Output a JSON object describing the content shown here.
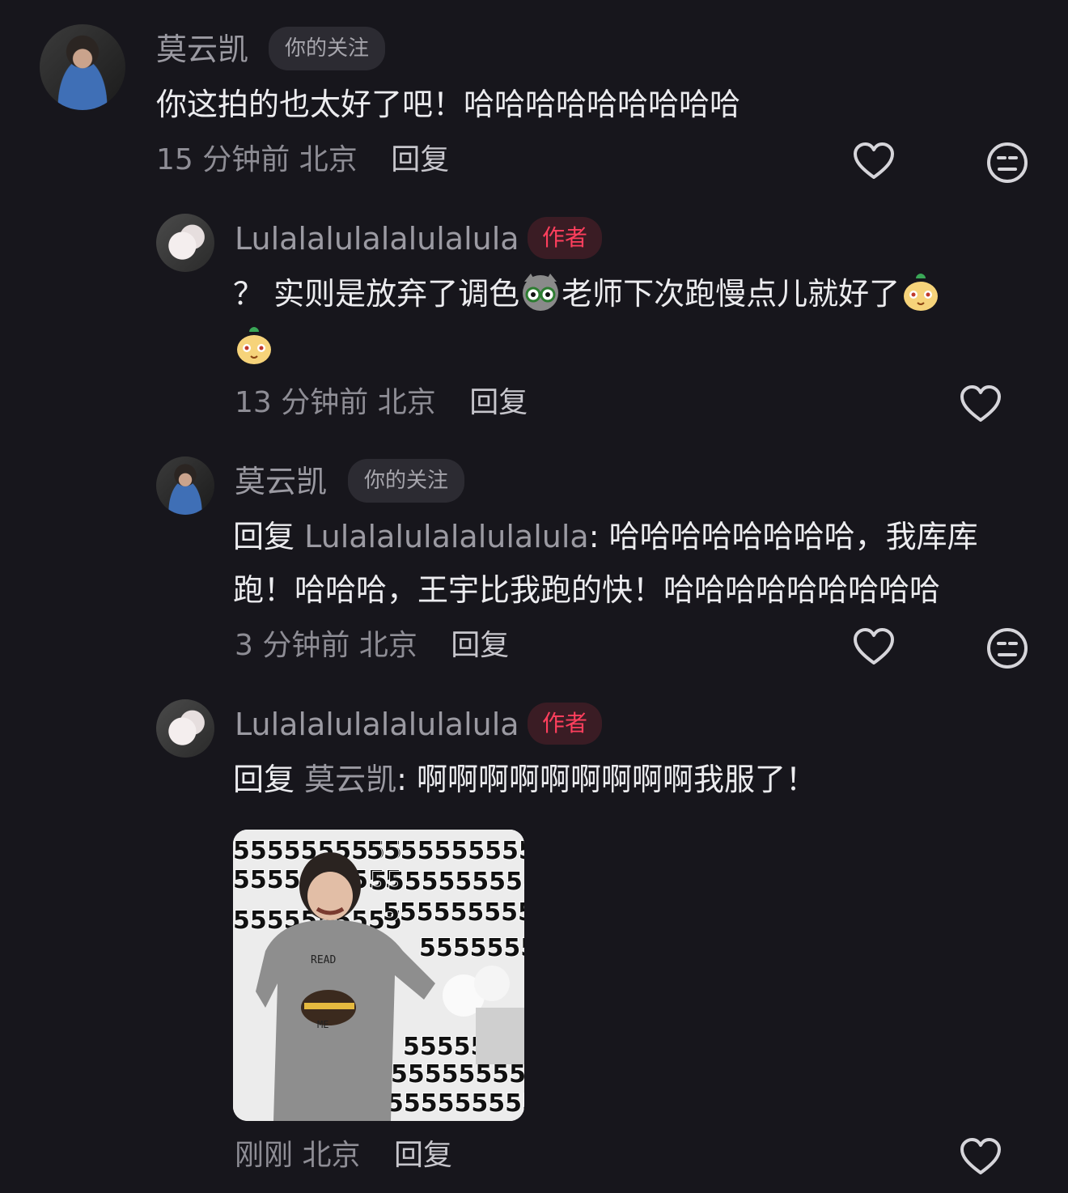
{
  "comments": [
    {
      "author": "莫云凯",
      "tag": "你的关注",
      "text": "你这拍的也太好了吧！哈哈哈哈哈哈哈哈哈",
      "time": "15 分钟前",
      "location": "北京",
      "reply_label": "回复",
      "icons": [
        "heart-icon",
        "meh-face-icon"
      ]
    },
    {
      "author": "Lulalalulalalulalula",
      "tag": "作者",
      "text_part1": "？ 实则是放弃了调色",
      "text_part2": "老师下次跑慢点儿就好了",
      "emojis": [
        "cat-glasses-emoji",
        "pear-face-emoji",
        "pear-face-emoji"
      ],
      "time": "13 分钟前",
      "location": "北京",
      "reply_label": "回复",
      "icons": [
        "heart-icon"
      ]
    },
    {
      "author": "莫云凯",
      "tag": "你的关注",
      "reply_prefix": "回复",
      "reply_target": "Lulalalulalalulalula",
      "line1_rest": ": 哈哈哈哈哈哈哈哈，我库库",
      "line2": "跑！哈哈哈，王宇比我跑的快！哈哈哈哈哈哈哈哈哈",
      "time": "3 分钟前",
      "location": "北京",
      "reply_label": "回复",
      "icons": [
        "heart-icon",
        "meh-face-icon"
      ]
    },
    {
      "author": "Lulalalulalalulalula",
      "tag": "作者",
      "reply_prefix": "回复",
      "reply_target": "莫云凯",
      "text_rest": ": 啊啊啊啊啊啊啊啊啊我服了！",
      "meme_text": "5555555555",
      "meme_shirt_top": "READ",
      "meme_shirt_bottom": "ME",
      "time": "刚刚",
      "location": "北京",
      "reply_label": "回复",
      "icons": [
        "heart-icon"
      ]
    }
  ]
}
